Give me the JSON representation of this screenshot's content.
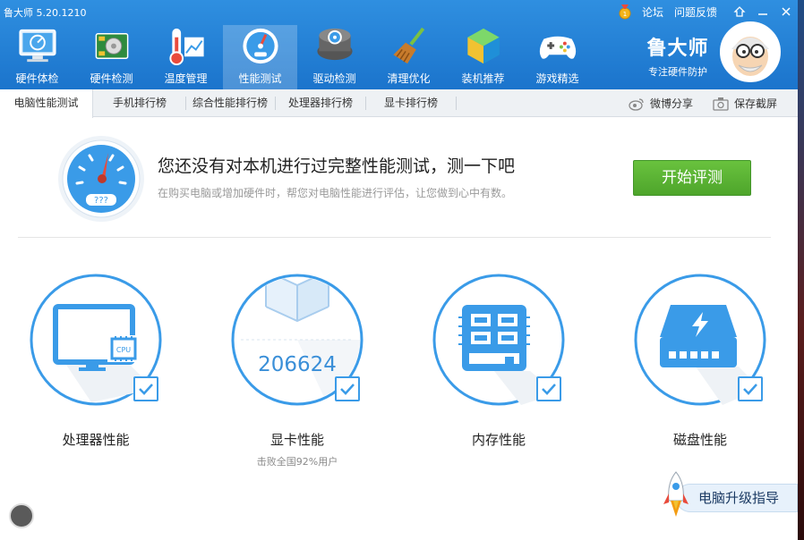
{
  "window": {
    "title": "鲁大师 5.20.1210"
  },
  "topbar": {
    "forum": "论坛",
    "feedback": "问题反馈",
    "skin_icon": "skin-icon",
    "min_icon": "minimize-icon",
    "close_icon": "close-icon"
  },
  "nav": [
    {
      "label": "硬件体检",
      "icon": "monitor-check-icon"
    },
    {
      "label": "硬件检测",
      "icon": "hardware-board-icon"
    },
    {
      "label": "温度管理",
      "icon": "thermometer-icon"
    },
    {
      "label": "性能测试",
      "icon": "gauge-icon",
      "active": true
    },
    {
      "label": "驱动检测",
      "icon": "driver-gear-icon"
    },
    {
      "label": "清理优化",
      "icon": "broom-icon"
    },
    {
      "label": "装机推荐",
      "icon": "cube-icon"
    },
    {
      "label": "游戏精选",
      "icon": "gamepad-icon"
    }
  ],
  "brand": {
    "name": "鲁大师",
    "slogan": "专注硬件防护"
  },
  "tabs": [
    {
      "label": "电脑性能测试",
      "active": true
    },
    {
      "label": "手机排行榜"
    },
    {
      "label": "综合性能排行榜"
    },
    {
      "label": "处理器排行榜"
    },
    {
      "label": "显卡排行榜"
    }
  ],
  "actions": {
    "weibo_share": "微博分享",
    "save_screenshot": "保存截屏"
  },
  "banner": {
    "gauge_text": "???",
    "title": "您还没有对本机进行过完整性能测试，测一下吧",
    "subtitle": "在购买电脑或增加硬件时，帮您对电脑性能进行评估，让您做到心中有数。",
    "start_button": "开始评测"
  },
  "cards": [
    {
      "label": "处理器性能",
      "icon": "cpu-monitor-icon",
      "cpu_chip_text": "CPU"
    },
    {
      "label": "显卡性能",
      "icon": "graphics-cube-icon",
      "score": "206624",
      "sublabel": "击败全国92%用户"
    },
    {
      "label": "内存性能",
      "icon": "memory-icon"
    },
    {
      "label": "磁盘性能",
      "icon": "disk-icon"
    }
  ],
  "upgrade": {
    "label": "电脑升级指导",
    "icon": "rocket-icon"
  },
  "colors": {
    "header": "#1b74cc",
    "accent": "#3a9be8",
    "start_button": "#5bb534"
  }
}
